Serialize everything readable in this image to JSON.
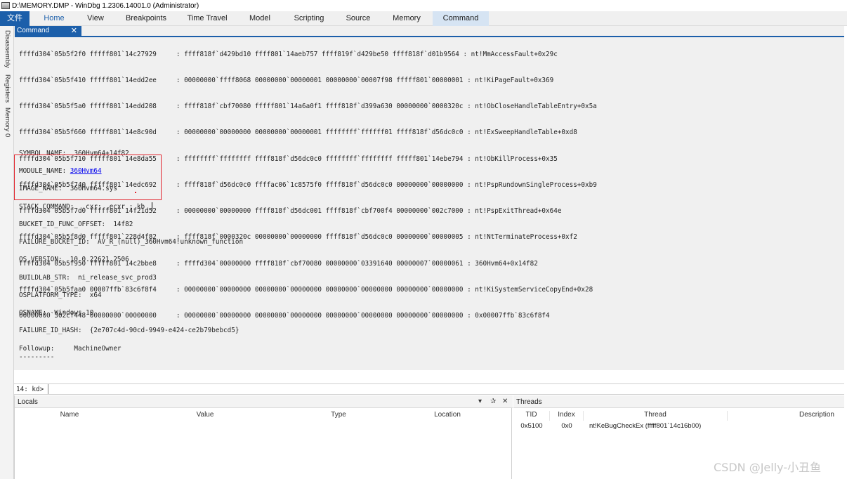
{
  "window": {
    "title": "D:\\MEMORY.DMP - WinDbg 1.2306.14001.0 (Administrator)"
  },
  "ribbon": {
    "tabs": [
      "文件",
      "Home",
      "View",
      "Breakpoints",
      "Time Travel",
      "Model",
      "Scripting",
      "Source",
      "Memory",
      "Command"
    ]
  },
  "side_tabs": [
    "Disassembly",
    "Registers",
    "Memory 0"
  ],
  "command_tab": {
    "label": "Command",
    "close": "✕"
  },
  "stack_lines": [
    "ffffd304`05b5f2f0 fffff801`14c27929     : ffff818f`d429bd10 ffff801`14aeb757 ffff819f`d429be50 ffff818f`d01b9564 : nt!MmAccessFault+0x29c",
    "ffffd304`05b5f410 fffff801`14edd2ee     : 00000000`ffff8068 00000000`00000001 00000000`00007f98 fffff801`00000001 : nt!KiPageFault+0x369",
    "ffffd304`05b5f5a0 fffff801`14edd208     : ffff818f`cbf70080 fffff801`14a6a0f1 ffff818f`d399a630 00000000`0000320c : nt!ObCloseHandleTableEntry+0x5a",
    "ffffd304`05b5f660 fffff801`14e8c90d     : 00000000`00000000 00000000`00000001 ffffffff`ffffff01 ffff818f`d56dc0c0 : nt!ExSweepHandleTable+0xd8",
    "ffffd304`05b5f710 fffff801`14e8da55     : ffffffff`ffffffff ffff818f`d56dc0c0 ffffffff`ffffffff fffff801`14ebe794 : nt!ObKillProcess+0x35",
    "ffffd304`05b5f740 fffff801`14edc692     : ffff818f`d56dc0c0 ffffac06`1c8575f0 ffff818f`d56dc0c0 00000000`00000000 : nt!PspRundownSingleProcess+0xb9",
    "ffffd304`05b5f7d0 fffff801`14f21d52     : 00000000`00000000 ffff818f`d56dc001 ffff818f`cbf700f4 00000000`002c7000 : nt!PspExitThread+0x64e",
    "ffffd304`05b5f8d0 fffff801`228d4f82     : ffff818f`0000320c 00000000`00000000 ffff818f`d56dc0c0 00000000`00000005 : nt!NtTerminateProcess+0xf2",
    "ffffd304`05b5f950 fffff801`14c2bbe8     : ffffd304`00000000 ffff818f`cbf70080 00000000`03391640 00000007`00000061 : 360Hvm64+0x14f82",
    "ffffd304`05b5faa0 00007ffb`83c6f8f4     : 00000000`00000000 00000000`00000000 00000000`00000000 00000000`00000000 : nt!KiSystemServiceCopyEnd+0x28",
    "00000000`302cf448 00000000`00000000     : 00000000`00000000 00000000`00000000 00000000`00000000 00000000`00000000 : 0x00007ffb`83c6f8f4"
  ],
  "fields": {
    "symbol_name": "SYMBOL_NAME:  360Hvm64+14f82",
    "module_label": "MODULE_NAME: ",
    "module_link": "360Hvm64",
    "image_name": "IMAGE_NAME:  360Hvm64.sys",
    "stack_command": "STACK_COMMAND:  .cxr; .ecxr ; kb",
    "bucket_offset": "BUCKET_ID_FUNC_OFFSET:  14f82",
    "failure_bucket": "FAILURE_BUCKET_ID:  AV_R_(null)_360Hvm64!unknown_function",
    "os_version": "OS_VERSION:  10.0.22621.2506",
    "buildlab": "BUILDLAB_STR:  ni_release_svc_prod3",
    "osplatform": "OSPLATFORM_TYPE:  x64",
    "osname": "OSNAME:  Windows 10",
    "failure_hash": "FAILURE_ID_HASH:  {2e707c4d-90cd-9949-e424-ce2b79bebcd5}",
    "followup": "Followup:     MachineOwner",
    "dashes": "---------"
  },
  "command": {
    "prompt": "14: kd>",
    "value": ""
  },
  "locals": {
    "title": "Locals",
    "columns": [
      "Name",
      "Value",
      "Type",
      "Location"
    ],
    "buttons": [
      "▾",
      "✰",
      "✕"
    ]
  },
  "threads": {
    "title": "Threads",
    "columns": [
      "TID",
      "Index",
      "Thread",
      "Description"
    ],
    "rows": [
      {
        "tid": "0x5100",
        "index": "0x0",
        "thread": "nt!KeBugCheckEx (fffff801`14c16b00)",
        "description": ""
      }
    ]
  },
  "watermark": "CSDN @Jelly-小丑鱼"
}
